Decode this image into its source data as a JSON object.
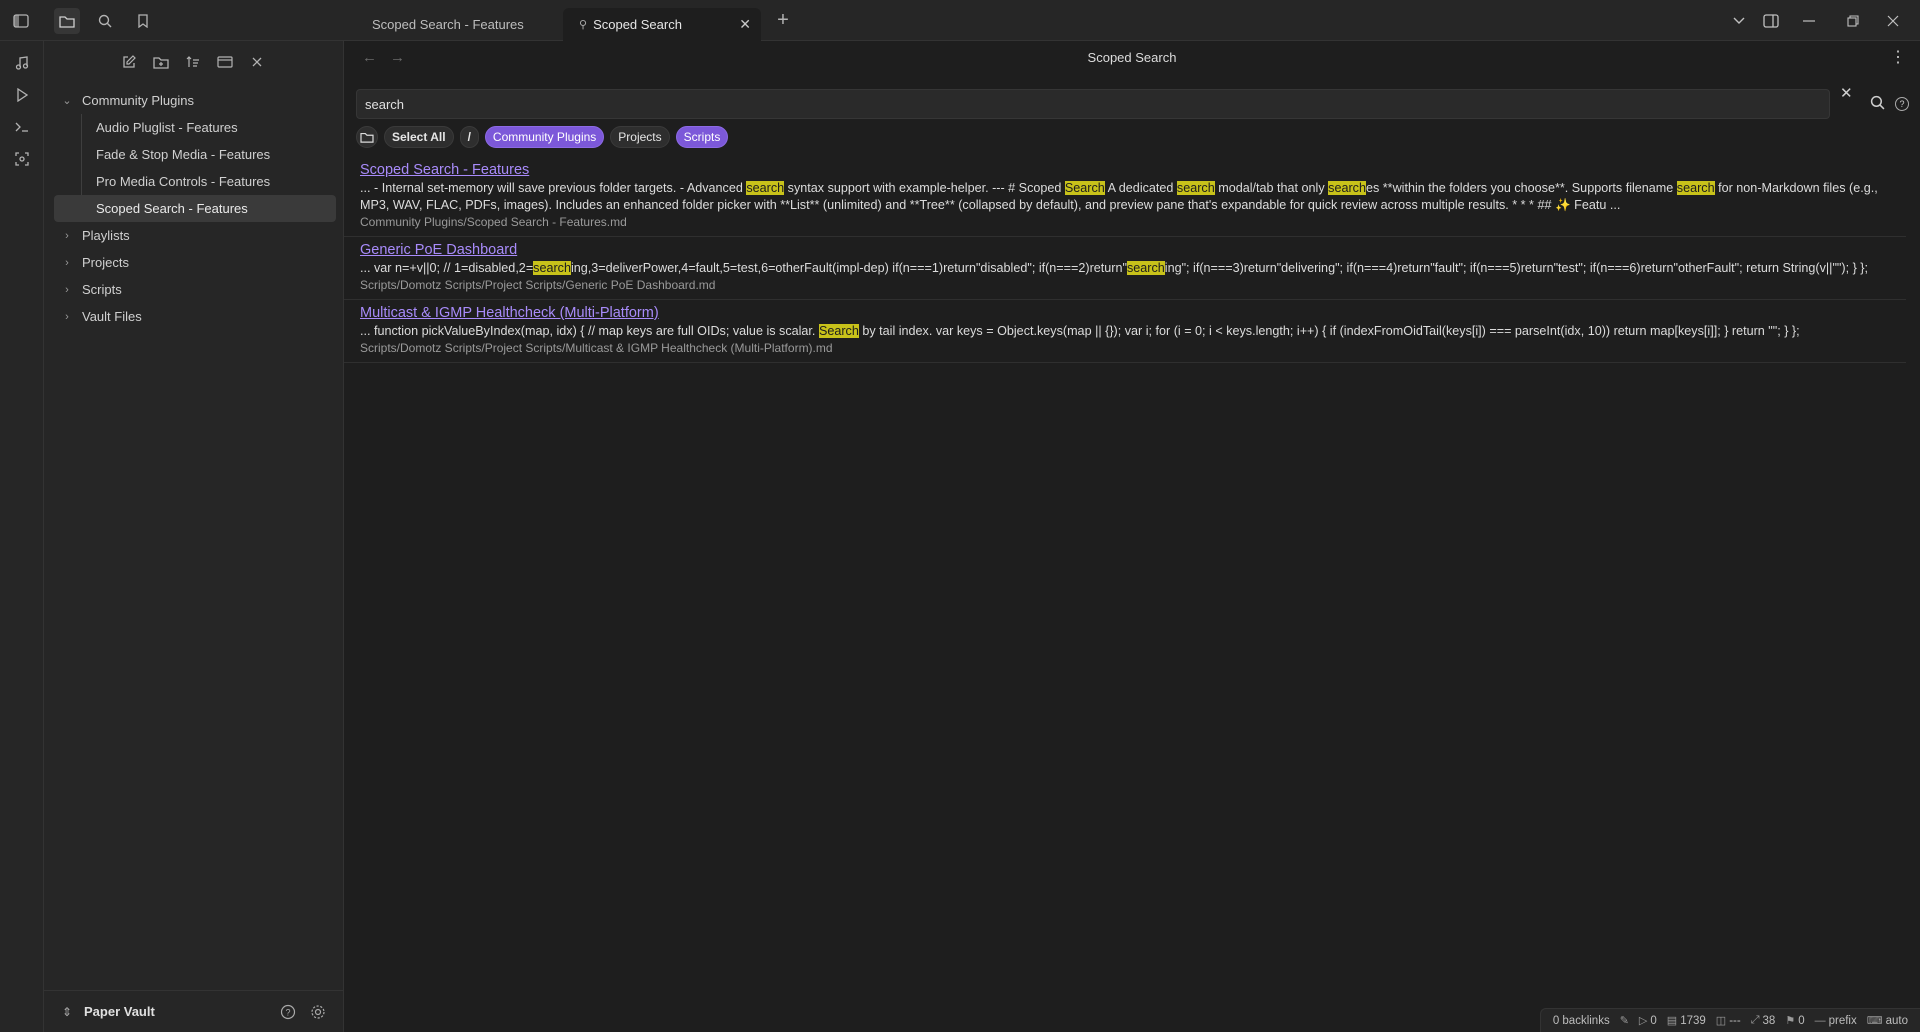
{
  "tabs": [
    {
      "label": "Scoped Search - Features",
      "active": false
    },
    {
      "label": "Scoped Search",
      "active": true
    }
  ],
  "sidebar": {
    "tree": [
      {
        "label": "Community Plugins",
        "expanded": true,
        "children": [
          "Audio Pluglist - Features",
          "Fade & Stop Media - Features",
          "Pro Media Controls - Features",
          "Scoped Search - Features"
        ]
      },
      {
        "label": "Playlists"
      },
      {
        "label": "Projects"
      },
      {
        "label": "Scripts"
      },
      {
        "label": "Vault Files"
      }
    ],
    "vault_name": "Paper Vault"
  },
  "view": {
    "title": "Scoped Search",
    "search_value": "search",
    "chips": {
      "select_all": "Select All",
      "root": "/",
      "community_plugins": "Community Plugins",
      "projects": "Projects",
      "scripts": "Scripts"
    }
  },
  "results": [
    {
      "title": "Scoped Search - Features",
      "snippet_parts": [
        {
          "t": "... - Internal set-memory will save previous folder targets. - Advanced "
        },
        {
          "t": "search",
          "hl": true
        },
        {
          "t": " syntax support with example-helper. --- # Scoped "
        },
        {
          "t": "Search",
          "hl": true
        },
        {
          "t": " A dedicated "
        },
        {
          "t": "search",
          "hl": true
        },
        {
          "t": " modal/tab that only "
        },
        {
          "t": "search",
          "hl": true
        },
        {
          "t": "es **within the folders you choose**. Supports filename "
        },
        {
          "t": "search",
          "hl": true
        },
        {
          "t": " for non-Markdown files (e.g., MP3, WAV, FLAC, PDFs, images). Includes an enhanced folder picker with **List** (unlimited) and **Tree** (collapsed by default), and preview pane that's expandable for quick review across multiple results. * * * ## ✨ Featu ..."
        }
      ],
      "path": "Community Plugins/Scoped Search - Features.md"
    },
    {
      "title": "Generic PoE Dashboard",
      "snippet_parts": [
        {
          "t": "... var n=+v||0; // 1=disabled,2="
        },
        {
          "t": "search",
          "hl": true
        },
        {
          "t": "ing,3=deliverPower,4=fault,5=test,6=otherFault(impl-dep) if(n===1)return\"disabled\"; if(n===2)return\""
        },
        {
          "t": "search",
          "hl": true
        },
        {
          "t": "ing\"; if(n===3)return\"delivering\"; if(n===4)return\"fault\"; if(n===5)return\"test\"; if(n===6)return\"otherFault\"; return String(v||\"\"); } };"
        }
      ],
      "path": "Scripts/Domotz Scripts/Project Scripts/Generic PoE Dashboard.md"
    },
    {
      "title": "Multicast & IGMP Healthcheck (Multi-Platform)",
      "snippet_parts": [
        {
          "t": "... function pickValueByIndex(map, idx) { // map keys are full OIDs; value is scalar. "
        },
        {
          "t": "Search",
          "hl": true
        },
        {
          "t": " by tail index. var keys = Object.keys(map || {}); var i; for (i = 0; i < keys.length; i++) { if (indexFromOidTail(keys[i]) === parseInt(idx, 10)) return map[keys[i]]; } return \"\"; } };"
        }
      ],
      "path": "Scripts/Domotz Scripts/Project Scripts/Multicast & IGMP Healthcheck (Multi-Platform).md"
    }
  ],
  "statusbar": {
    "backlinks": "0 backlinks",
    "edits": "0",
    "words": "1739",
    "cols": "---",
    "links": "38",
    "unresolved": "0",
    "mode": "prefix",
    "auto": "auto"
  },
  "colors": {
    "accent": "#7c58d9",
    "highlight": "#c8c21a",
    "link": "#a88bfa"
  }
}
